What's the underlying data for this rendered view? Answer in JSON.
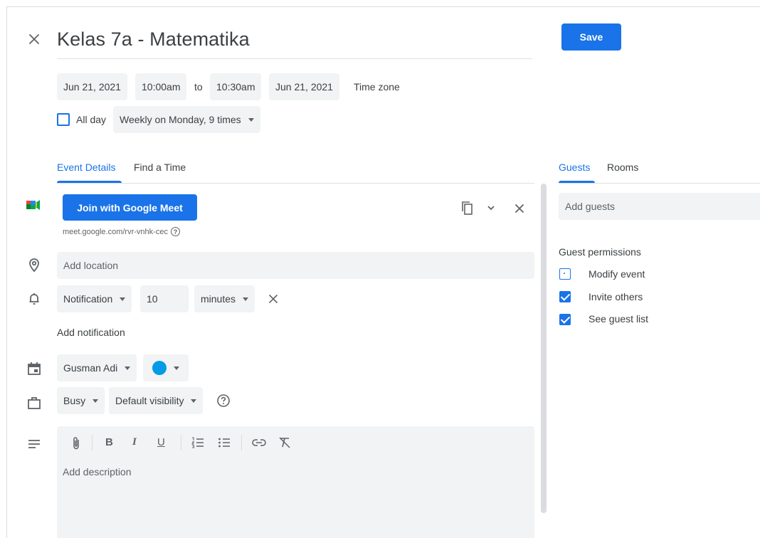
{
  "header": {
    "title": "Kelas 7a - Matematika",
    "save_label": "Save"
  },
  "datetime": {
    "start_date": "Jun 21, 2021",
    "start_time": "10:00am",
    "to_label": "to",
    "end_time": "10:30am",
    "end_date": "Jun 21, 2021",
    "timezone_label": "Time zone",
    "all_day_label": "All day",
    "all_day_checked": false,
    "recurrence": "Weekly on Monday, 9 times"
  },
  "tabs": {
    "left": [
      {
        "label": "Event Details",
        "active": true
      },
      {
        "label": "Find a Time",
        "active": false
      }
    ],
    "right": [
      {
        "label": "Guests",
        "active": true
      },
      {
        "label": "Rooms",
        "active": false
      }
    ]
  },
  "meet": {
    "button_label": "Join with Google Meet",
    "link": "meet.google.com/rvr-vnhk-cec"
  },
  "location": {
    "placeholder": "Add location"
  },
  "notification": {
    "type": "Notification",
    "value": "10",
    "unit": "minutes",
    "add_label": "Add notification"
  },
  "calendar": {
    "owner": "Gusman Adi",
    "color": "#039be5"
  },
  "availability": {
    "status": "Busy",
    "visibility": "Default visibility"
  },
  "description": {
    "placeholder": "Add description"
  },
  "guests": {
    "placeholder": "Add guests",
    "permissions_title": "Guest permissions",
    "permissions": [
      {
        "label": "Modify event",
        "checked": false
      },
      {
        "label": "Invite others",
        "checked": true
      },
      {
        "label": "See guest list",
        "checked": true
      }
    ]
  },
  "colors": {
    "accent": "#1a73e8",
    "chip_bg": "#f1f3f4"
  }
}
